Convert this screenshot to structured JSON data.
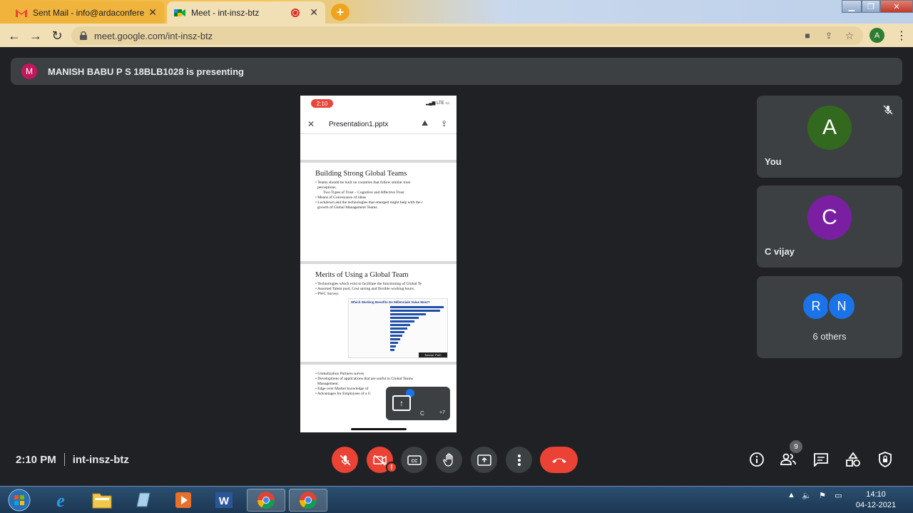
{
  "browser": {
    "tabs": [
      {
        "title": "Sent Mail - info@ardaconference",
        "icon": "gmail-icon"
      },
      {
        "title": "Meet - int-insz-btz",
        "icon": "meet-icon",
        "recording": true
      }
    ],
    "url": "meet.google.com/int-insz-btz",
    "profile_initial": "A"
  },
  "meet": {
    "presenting_initial": "M",
    "presenting_text": "MANISH BABU P S 18BLB1028 is presenting",
    "shared_screen": {
      "phone_time": "2:10",
      "phone_status": "LTE",
      "file_name": "Presentation1.pptx",
      "slide1": {
        "title": "Building Strong Global Teams",
        "bullets": [
          "• Teams should be built on countries that follow similar trust",
          "  perceptions.",
          "Two Types of Trust – Cognitive and Affective Trust",
          "• Means of Conveyance of ideas",
          "• Lockdown and the technologies that emerged might help with the r",
          "  growth of Global Management Teams."
        ]
      },
      "slide2": {
        "title": "Merits of Using a Global Team",
        "bullets": [
          "• Technologies which exist to facilitate the functioning of Global Te",
          "• Assorted Talent pool, Cost saving and flexible working hours.",
          "• PWC Survey:"
        ],
        "survey_title": "Which Working Benefits Do Millennials Value Most?",
        "survey_footer": "Source: PwC"
      },
      "slide3": {
        "bullets": [
          "• Globalization Partners survey",
          "• Development of applications that are useful to Global Teams",
          "  Management.",
          "• Edge over Market knowledge of",
          "• Advantages for Employees of a G"
        ]
      },
      "pip": {
        "name": "C",
        "more": "+7"
      }
    },
    "participants": [
      {
        "initial": "A",
        "name": "You",
        "color": "#33691e",
        "muted": true
      },
      {
        "initial": "C",
        "name": "C vijay",
        "color": "#7b1fa2",
        "muted": false
      }
    ],
    "others": {
      "initials": [
        "R",
        "N"
      ],
      "label": "6 others"
    },
    "bottom": {
      "time": "2:10 PM",
      "meeting_code": "int-insz-btz",
      "people_count": "9"
    }
  },
  "taskbar": {
    "clock_time": "14:10",
    "clock_date": "04-12-2021"
  }
}
